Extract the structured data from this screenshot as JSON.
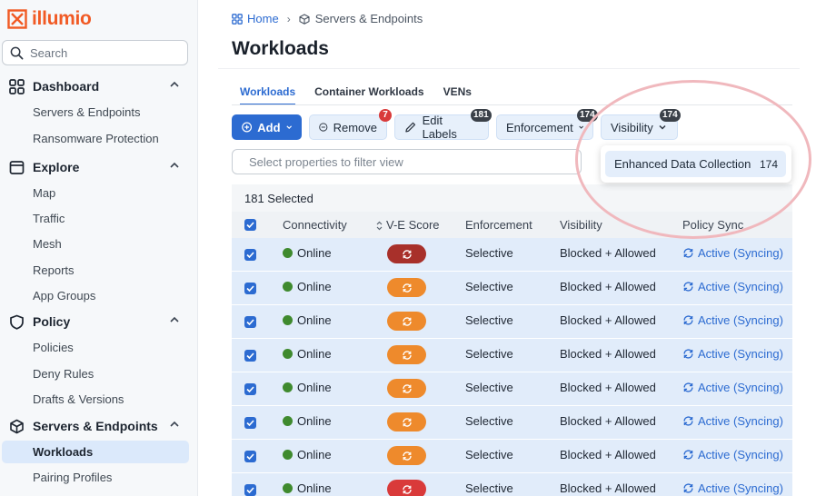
{
  "brand": {
    "name": "illumio",
    "color": "#f15a24"
  },
  "search": {
    "placeholder": "Search"
  },
  "sidebar": {
    "sections": [
      {
        "label": "Dashboard",
        "icon": "grid-icon"
      },
      {
        "label": "Explore",
        "icon": "window-icon"
      },
      {
        "label": "Policy",
        "icon": "shield-icon"
      },
      {
        "label": "Servers & Endpoints",
        "icon": "cube-icon"
      }
    ],
    "items": [
      "Servers & Endpoints",
      "Ransomware Protection",
      "Map",
      "Traffic",
      "Mesh",
      "Reports",
      "App Groups",
      "Policies",
      "Deny Rules",
      "Drafts & Versions",
      "Workloads",
      "Pairing Profiles"
    ],
    "active_item": "Workloads"
  },
  "breadcrumb": {
    "home": "Home",
    "current": "Servers & Endpoints"
  },
  "page": {
    "title": "Workloads"
  },
  "tabs": [
    "Workloads",
    "Container Workloads",
    "VENs"
  ],
  "toolbar": {
    "add": "Add",
    "remove": "Remove",
    "remove_badge": "7",
    "edit_labels": "Edit Labels",
    "edit_labels_badge": "181",
    "enforcement": "Enforcement",
    "enforcement_badge": "174",
    "visibility": "Visibility",
    "visibility_badge": "174"
  },
  "filter": {
    "placeholder": "Select properties to filter view"
  },
  "dropdown": {
    "label": "Enhanced Data Collection",
    "count": "174"
  },
  "table": {
    "selected_text": "181 Selected",
    "columns": [
      "Connectivity",
      "V-E Score",
      "Enforcement",
      "Visibility",
      "Policy Sync"
    ],
    "rows": [
      {
        "connectivity": "Online",
        "score_color": "#a8302a",
        "enforcement": "Selective",
        "visibility": "Blocked + Allowed",
        "policy_sync": "Active (Syncing)"
      },
      {
        "connectivity": "Online",
        "score_color": "#ee8a2c",
        "enforcement": "Selective",
        "visibility": "Blocked + Allowed",
        "policy_sync": "Active (Syncing)"
      },
      {
        "connectivity": "Online",
        "score_color": "#ee8a2c",
        "enforcement": "Selective",
        "visibility": "Blocked + Allowed",
        "policy_sync": "Active (Syncing)"
      },
      {
        "connectivity": "Online",
        "score_color": "#ee8a2c",
        "enforcement": "Selective",
        "visibility": "Blocked + Allowed",
        "policy_sync": "Active (Syncing)"
      },
      {
        "connectivity": "Online",
        "score_color": "#ee8a2c",
        "enforcement": "Selective",
        "visibility": "Blocked + Allowed",
        "policy_sync": "Active (Syncing)"
      },
      {
        "connectivity": "Online",
        "score_color": "#ee8a2c",
        "enforcement": "Selective",
        "visibility": "Blocked + Allowed",
        "policy_sync": "Active (Syncing)"
      },
      {
        "connectivity": "Online",
        "score_color": "#ee8a2c",
        "enforcement": "Selective",
        "visibility": "Blocked + Allowed",
        "policy_sync": "Active (Syncing)"
      },
      {
        "connectivity": "Online",
        "score_color": "#d93a3a",
        "enforcement": "Selective",
        "visibility": "Blocked + Allowed",
        "policy_sync": "Active (Syncing)"
      }
    ]
  },
  "colors": {
    "accent": "#2c6bd1",
    "online": "#3f8a2e",
    "highlight_ring": "#f0b8bd"
  }
}
